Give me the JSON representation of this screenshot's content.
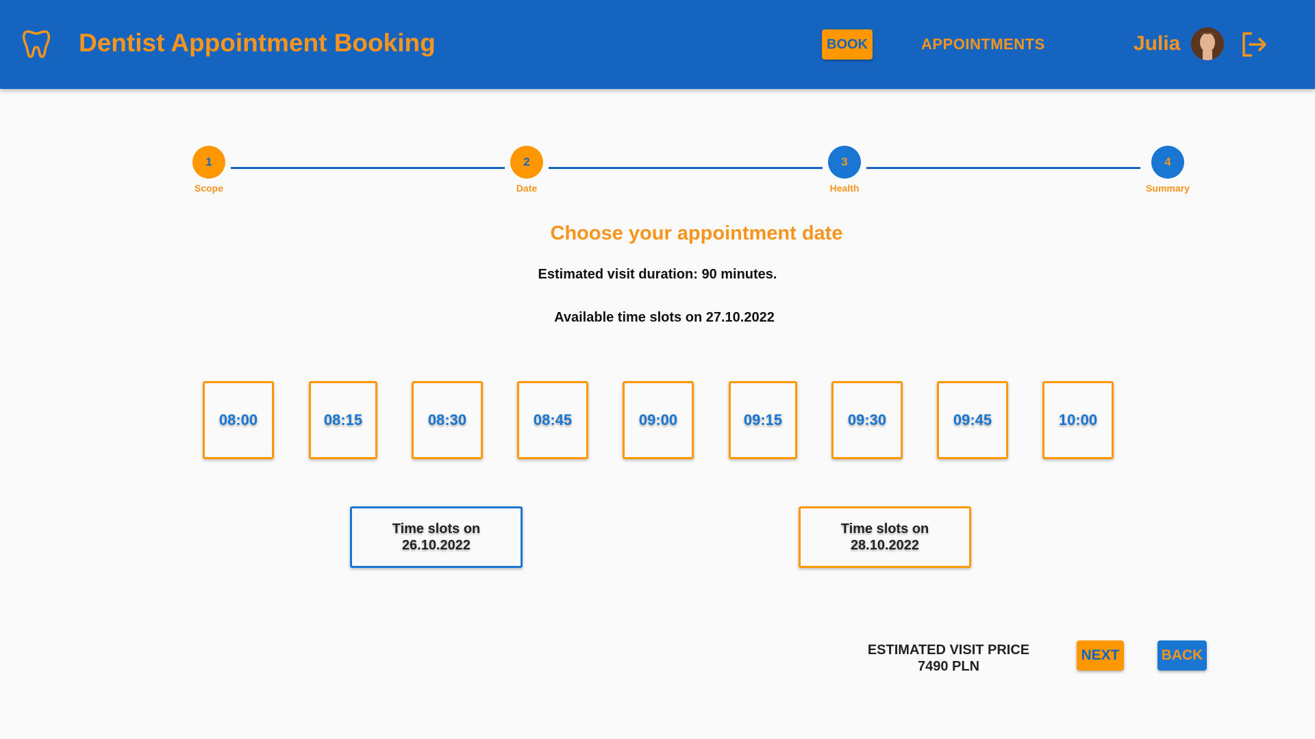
{
  "header": {
    "app_title": "Dentist Appointment Booking",
    "logo_icon": "tooth-icon",
    "nav_book": "BOOK",
    "nav_appointments": "APPOINTMENTS",
    "user_name": "Julia",
    "logout_icon": "logout-icon"
  },
  "stepper": {
    "steps": [
      {
        "number": "1",
        "label": "Scope"
      },
      {
        "number": "2",
        "label": "Date"
      },
      {
        "number": "3",
        "label": "Health"
      },
      {
        "number": "4",
        "label": "Summary"
      }
    ]
  },
  "main": {
    "heading": "Choose your appointment date",
    "duration_text": "Estimated visit duration: 90 minutes.",
    "available_text": "Available time slots on 27.10.2022",
    "slots": [
      "08:00",
      "08:15",
      "08:30",
      "08:45",
      "09:00",
      "09:15",
      "09:30",
      "09:45",
      "10:00"
    ],
    "prev_day": {
      "line1": "Time slots on",
      "line2": "26.10.2022"
    },
    "next_day": {
      "line1": "Time slots on",
      "line2": "28.10.2022"
    }
  },
  "footer": {
    "price_label": "ESTIMATED VISIT PRICE",
    "price_value": "7490 PLN",
    "next_label": "NEXT",
    "back_label": "BACK"
  },
  "colors": {
    "primary_blue": "#1565c0",
    "accent_orange": "#ff9800",
    "text_orange": "#f7941d"
  }
}
